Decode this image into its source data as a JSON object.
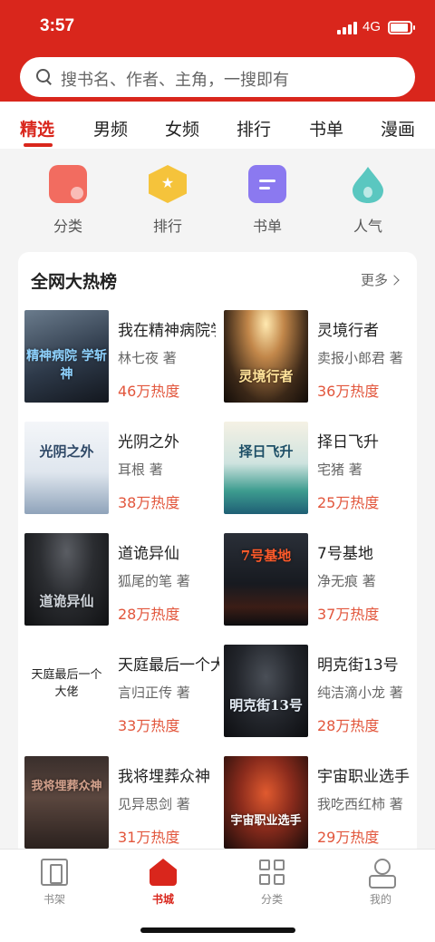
{
  "status": {
    "time": "3:57",
    "network": "4G"
  },
  "search": {
    "placeholder": "搜书名、作者、主角，一搜即有"
  },
  "tabs": [
    "精选",
    "男频",
    "女频",
    "排行",
    "书单",
    "漫画"
  ],
  "quick": [
    {
      "label": "分类",
      "icon": "category-icon",
      "color": "#f26c60"
    },
    {
      "label": "排行",
      "icon": "ranking-medal-icon",
      "color": "#f5c33b"
    },
    {
      "label": "书单",
      "icon": "booklist-icon",
      "color": "#8b79f0"
    },
    {
      "label": "人气",
      "icon": "popularity-flame-icon",
      "color": "#5ac7c0"
    }
  ],
  "hotlist": {
    "title": "全网大热榜",
    "more": "更多",
    "books": [
      {
        "title": "我在精神病院学斩神",
        "author": "林七夜 著",
        "heat": "46万热度",
        "cover_title": "精神病院 学斩神"
      },
      {
        "title": "灵境行者",
        "author": "卖报小郎君 著",
        "heat": "36万热度",
        "cover_title": "灵境行者"
      },
      {
        "title": "光阴之外",
        "author": "耳根 著",
        "heat": "38万热度",
        "cover_title": "光阴之外"
      },
      {
        "title": "择日飞升",
        "author": "宅猪 著",
        "heat": "25万热度",
        "cover_title": "择日飞升"
      },
      {
        "title": "道诡异仙",
        "author": "狐尾的笔 著",
        "heat": "28万热度",
        "cover_title": "道诡异仙"
      },
      {
        "title": "7号基地",
        "author": "净无痕 著",
        "heat": "37万热度",
        "cover_title": "7号基地"
      },
      {
        "title": "天庭最后一个大佬",
        "author": "言归正传 著",
        "heat": "33万热度",
        "cover_title": "天庭最后一个 大佬"
      },
      {
        "title": "明克街13号",
        "author": "纯洁滴小龙 著",
        "heat": "28万热度",
        "cover_title": "明克街13号"
      },
      {
        "title": "我将埋葬众神",
        "author": "见异思剑 著",
        "heat": "31万热度",
        "cover_title": "我将埋葬众神"
      },
      {
        "title": "宇宙职业选手",
        "author": "我吃西红柿 著",
        "heat": "29万热度",
        "cover_title": "宇宙职业选手"
      }
    ]
  },
  "nav": [
    {
      "label": "书架",
      "icon": "bookshelf-icon"
    },
    {
      "label": "书城",
      "icon": "bookstore-icon",
      "active": true
    },
    {
      "label": "分类",
      "icon": "category-grid-icon"
    },
    {
      "label": "我的",
      "icon": "profile-icon"
    }
  ]
}
